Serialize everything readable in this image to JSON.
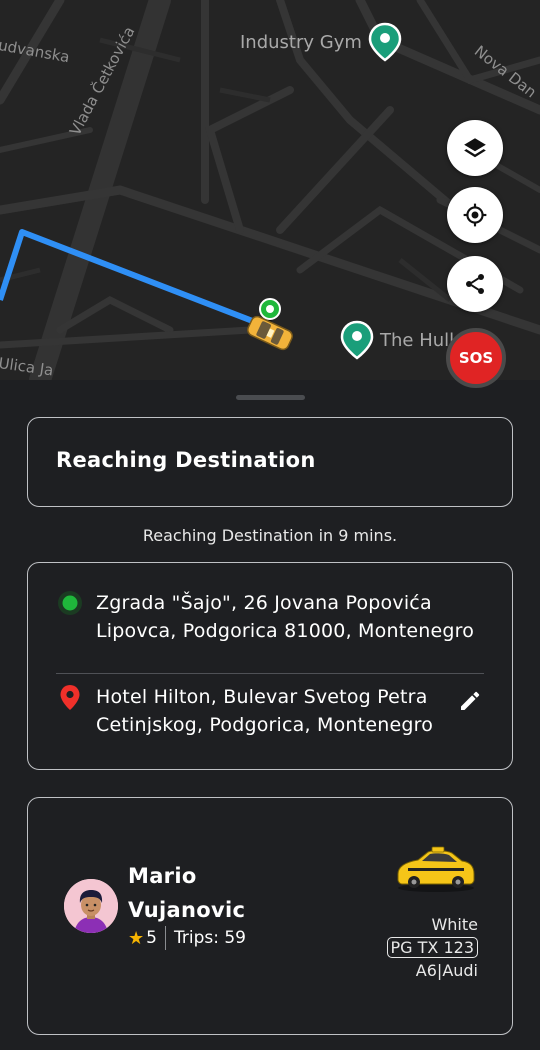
{
  "map": {
    "road_labels": [
      "udvanska",
      "Vlada Četkovića",
      "Nova Dan",
      "Ulica Ja"
    ],
    "pois": [
      {
        "label": "Industry Gym",
        "icon": "map-pin-icon"
      },
      {
        "label": "The Hull",
        "icon": "map-pin-icon"
      }
    ],
    "route_color": "#2f8ff5",
    "buttons": {
      "layers": "layers-icon",
      "locate": "my-location-icon",
      "share": "share-icon",
      "sos_label": "SOS"
    }
  },
  "sheet": {
    "status_title": "Reaching Destination",
    "eta_text": "Reaching Destination in 9 mins.",
    "pickup": {
      "icon": "pickup-dot-icon",
      "line1": "Zgrada \"Šajo\", 26 Jovana Popovića",
      "line2": "Lipovca, Podgorica 81000, Montenegro"
    },
    "drop": {
      "icon": "location-pin-icon",
      "line1": "Hotel Hilton, Bulevar Svetog Petra",
      "line2": "Cetinjskog, Podgorica, Montenegro",
      "edit_icon": "pencil-icon"
    },
    "driver": {
      "first_name": "Mario",
      "last_name": "Vujanovic",
      "rating": "5",
      "trips": "Trips: 59",
      "car_color": "White",
      "plate": "PG TX 123",
      "model": "A6",
      "make": "Audi",
      "car_separator": "|"
    }
  },
  "colors": {
    "background": "#1e1f22",
    "card_border": "#bfc1c5",
    "pickup_green": "#1fb83b",
    "drop_red": "#f0302a",
    "sos_red": "#e02424",
    "star": "#f5b301"
  }
}
